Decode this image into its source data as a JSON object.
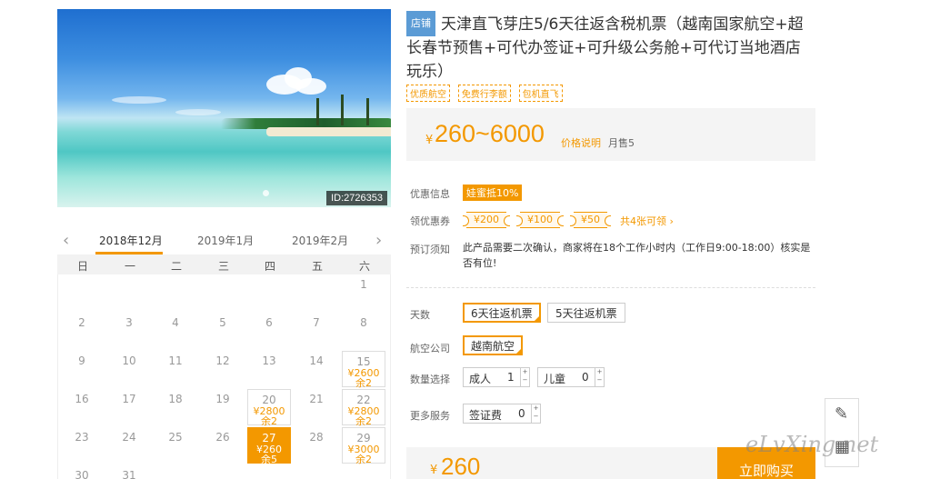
{
  "hero": {
    "id_badge": "ID:2726353"
  },
  "calendar": {
    "prev_arrow": "‹",
    "next_arrow": "›",
    "months": [
      "2018年12月",
      "2019年1月",
      "2019年2月"
    ],
    "weekdays": [
      "日",
      "一",
      "二",
      "三",
      "四",
      "五",
      "六"
    ],
    "days": [
      {
        "d": "1",
        "p": ""
      },
      {
        "d": "2",
        "p": ""
      },
      {
        "d": "3",
        "p": ""
      },
      {
        "d": "4",
        "p": ""
      },
      {
        "d": "5",
        "p": ""
      },
      {
        "d": "6",
        "p": ""
      },
      {
        "d": "7",
        "p": ""
      },
      {
        "d": "8",
        "p": ""
      },
      {
        "d": "9",
        "p": ""
      },
      {
        "d": "10",
        "p": ""
      },
      {
        "d": "11",
        "p": ""
      },
      {
        "d": "12",
        "p": ""
      },
      {
        "d": "13",
        "p": ""
      },
      {
        "d": "14",
        "p": ""
      },
      {
        "d": "15",
        "p": "¥2600",
        "r": "余2"
      },
      {
        "d": "16",
        "p": ""
      },
      {
        "d": "17",
        "p": ""
      },
      {
        "d": "18",
        "p": ""
      },
      {
        "d": "19",
        "p": ""
      },
      {
        "d": "20",
        "p": "¥2800",
        "r": "余2"
      },
      {
        "d": "21",
        "p": ""
      },
      {
        "d": "22",
        "p": "¥2800",
        "r": "余2"
      },
      {
        "d": "23",
        "p": ""
      },
      {
        "d": "24",
        "p": ""
      },
      {
        "d": "25",
        "p": ""
      },
      {
        "d": "26",
        "p": ""
      },
      {
        "d": "27",
        "p": "¥260",
        "r": "余5"
      },
      {
        "d": "28",
        "p": ""
      },
      {
        "d": "29",
        "p": "¥3000",
        "r": "余2"
      },
      {
        "d": "30",
        "p": ""
      },
      {
        "d": "31",
        "p": ""
      }
    ]
  },
  "product": {
    "shop_tag": "店铺",
    "title": "天津直飞芽庄5/6天往返含税机票（越南国家航空+超长春节预售+可代办签证+可升级公务舱+可代订当地酒店玩乐）",
    "tags": [
      "优质航空",
      "免费行李额",
      "包机直飞"
    ],
    "price_yen": "¥",
    "price_range": "260~6000",
    "price_explain": "价格说明",
    "sold": "月售5"
  },
  "info": {
    "promo_label": "优惠信息",
    "promo_badge": "娃蜜抵10%",
    "coupon_label": "领优惠券",
    "coupons": [
      "¥200",
      "¥100",
      "¥50"
    ],
    "coupon_more": "共4张可领 ›",
    "notice_label": "预订须知",
    "notice_text": "此产品需要二次确认，商家将在18个工作小时内（工作日9:00-18:00）核实是否有位!"
  },
  "options": {
    "days_label": "天数",
    "days": [
      "6天往返机票",
      "5天往返机票"
    ],
    "airline_label": "航空公司",
    "airline": "越南航空",
    "qty_label": "数量选择",
    "adult_label": "成人",
    "adult_value": "1",
    "child_label": "儿童",
    "child_value": "0",
    "more_label": "更多服务",
    "visa_label": "签证费",
    "visa_value": "0"
  },
  "bottom": {
    "yen": "¥",
    "price": "260",
    "buy_label": "立即购买"
  },
  "watermark": "eLvXing.net"
}
